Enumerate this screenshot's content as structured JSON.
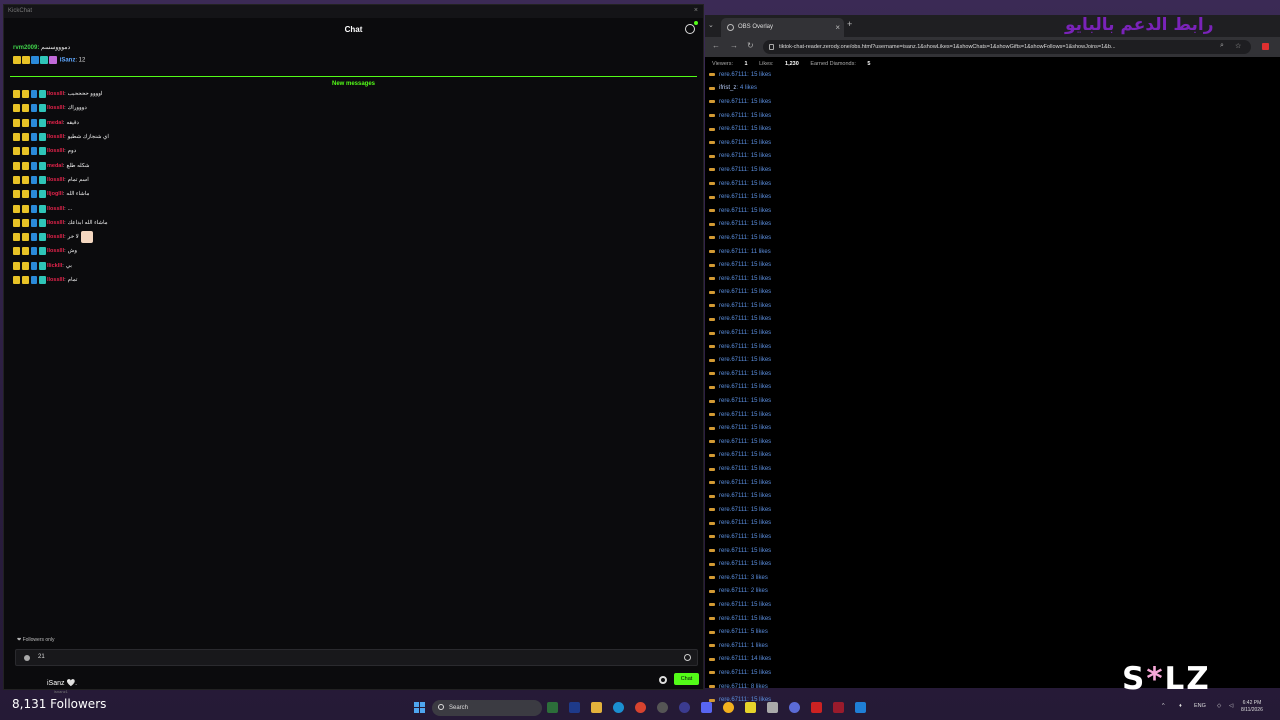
{
  "kick": {
    "window_title": "KickChat",
    "close": "×",
    "header_title": "Chat",
    "pinned_user": "rvm2009:",
    "pinned_text": "دموووسسم",
    "viewer_name": "iSanz",
    "viewer_suffix": ": 12",
    "new_messages": "New messages",
    "messages": [
      {
        "name": "llosslll",
        "text": "اوووو ححححبب"
      },
      {
        "name": "llosslll",
        "text": "دوووراك"
      },
      {
        "name": "medal",
        "text": "دقيقه"
      },
      {
        "name": "llosslll",
        "text": "اي شنجازك شطيو"
      },
      {
        "name": "llosslll",
        "text": "دوم"
      },
      {
        "name": "medal",
        "text": "شكله طلع"
      },
      {
        "name": "llosslll",
        "text": "اسم تمام"
      },
      {
        "name": "lljoglll",
        "text": "ماشاء الله"
      },
      {
        "name": "llosslll",
        "text": "..."
      },
      {
        "name": "llosslll",
        "text": "ماشاء الله ابداعك"
      },
      {
        "name": "llosslll",
        "text": "لا خر"
      },
      {
        "name": "llosslll",
        "text": "وش"
      },
      {
        "name": "Ilicklll",
        "text": "بي"
      },
      {
        "name": "llosslll",
        "text": "تمام"
      }
    ],
    "followers_only": "Followers only",
    "input_value": "21",
    "username": "iSanz 🤍.",
    "username_sub": "isnanz1",
    "chat_button": "Chat"
  },
  "browser": {
    "tab_title": "OBS Overlay",
    "tab_close": "×",
    "tab_new": "+",
    "overlay_title": "رابط الدعم بالبايو",
    "url": "tiktok-chat-reader.zerody.one/obs.html?username=isanz.1&showLikes=1&showChats=1&showGifts=1&showFollows=1&showJoins=1&b...",
    "stats": {
      "viewers_label": "Viewers:",
      "viewers_value": "1",
      "likes_label": "Likes:",
      "likes_value": "1,230",
      "diamonds_label": "Earned Diamonds:",
      "diamonds_value": "5"
    },
    "likes": [
      {
        "name": "rere.67111",
        "text": "15 likes"
      },
      {
        "name": "ifrist_z",
        "text": "4 likes",
        "alt": true
      },
      {
        "name": "rere.67111",
        "text": "15 likes"
      },
      {
        "name": "rere.67111",
        "text": "15 likes"
      },
      {
        "name": "rere.67111",
        "text": "15 likes"
      },
      {
        "name": "rere.67111",
        "text": "15 likes"
      },
      {
        "name": "rere.67111",
        "text": "15 likes"
      },
      {
        "name": "rere.67111",
        "text": "15 likes"
      },
      {
        "name": "rere.67111",
        "text": "15 likes"
      },
      {
        "name": "rere.67111",
        "text": "15 likes"
      },
      {
        "name": "rere.67111",
        "text": "15 likes"
      },
      {
        "name": "rere.67111",
        "text": "15 likes"
      },
      {
        "name": "rere.67111",
        "text": "15 likes"
      },
      {
        "name": "rere.67111",
        "text": "11 likes"
      },
      {
        "name": "rere.67111",
        "text": "15 likes"
      },
      {
        "name": "rere.67111",
        "text": "15 likes"
      },
      {
        "name": "rere.67111",
        "text": "15 likes"
      },
      {
        "name": "rere.67111",
        "text": "15 likes"
      },
      {
        "name": "rere.67111",
        "text": "15 likes"
      },
      {
        "name": "rere.67111",
        "text": "15 likes"
      },
      {
        "name": "rere.67111",
        "text": "15 likes"
      },
      {
        "name": "rere.67111",
        "text": "15 likes"
      },
      {
        "name": "rere.67111",
        "text": "15 likes"
      },
      {
        "name": "rere.67111",
        "text": "15 likes"
      },
      {
        "name": "rere.67111",
        "text": "15 likes"
      },
      {
        "name": "rere.67111",
        "text": "15 likes"
      },
      {
        "name": "rere.67111",
        "text": "15 likes"
      },
      {
        "name": "rere.67111",
        "text": "15 likes"
      },
      {
        "name": "rere.67111",
        "text": "15 likes"
      },
      {
        "name": "rere.67111",
        "text": "15 likes"
      },
      {
        "name": "rere.67111",
        "text": "15 likes"
      },
      {
        "name": "rere.67111",
        "text": "15 likes"
      },
      {
        "name": "rere.67111",
        "text": "15 likes"
      },
      {
        "name": "rere.67111",
        "text": "15 likes"
      },
      {
        "name": "rere.67111",
        "text": "15 likes"
      },
      {
        "name": "rere.67111",
        "text": "15 likes"
      },
      {
        "name": "rere.67111",
        "text": "15 likes"
      },
      {
        "name": "rere.67111",
        "text": "3 likes"
      },
      {
        "name": "rere.67111",
        "text": "2 likes"
      },
      {
        "name": "rere.67111",
        "text": "15 likes"
      },
      {
        "name": "rere.67111",
        "text": "15 likes"
      },
      {
        "name": "rere.67111",
        "text": "5 likes"
      },
      {
        "name": "rere.67111",
        "text": "1 likes"
      },
      {
        "name": "rere.67111",
        "text": "14 likes"
      },
      {
        "name": "rere.67111",
        "text": "15 likes"
      },
      {
        "name": "rere.67111",
        "text": "8 likes"
      },
      {
        "name": "rere.67111",
        "text": "15 likes"
      }
    ]
  },
  "stream": {
    "followers": "8,131 Followers",
    "logo_text": "S*LZ"
  },
  "taskbar": {
    "search": "Search",
    "lang": "ENG",
    "time": "6:42 PM",
    "date": "8/11/2026"
  },
  "colors": {
    "kick_green": "#53fc18",
    "name_red": "#e4234b",
    "like_blue": "#5b8fe0",
    "overlay_purple": "#7a23b9"
  }
}
